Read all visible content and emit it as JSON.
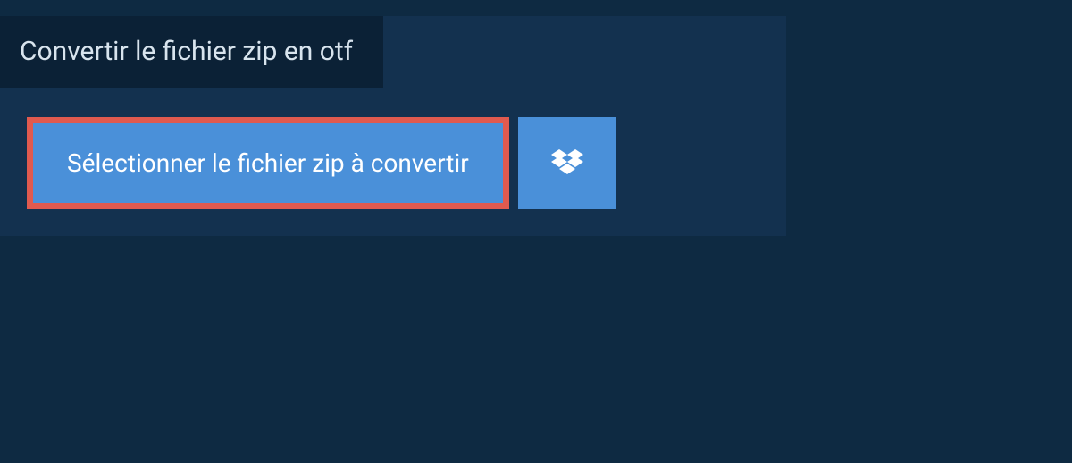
{
  "tab": {
    "title": "Convertir le fichier zip en otf"
  },
  "actions": {
    "select_file_label": "Sélectionner le fichier zip à convertir",
    "dropbox_icon_name": "dropbox"
  }
}
